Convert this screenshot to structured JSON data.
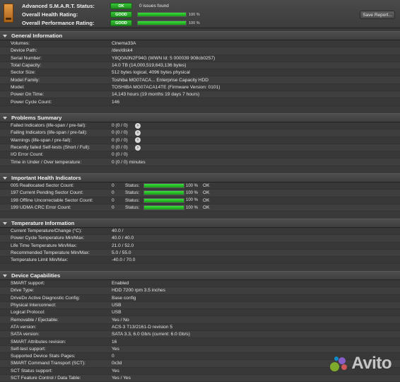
{
  "header": {
    "rows": [
      {
        "label": "Advanced S.M.A.R.T. Status:",
        "badge": "OK",
        "text": "0 issues found"
      },
      {
        "label": "Overall Health Rating:",
        "badge": "GOOD",
        "bar": 1.0,
        "pct": "100 %"
      },
      {
        "label": "Overall Performance Rating:",
        "badge": "GOOD",
        "bar": 1.0,
        "pct": "100 %"
      }
    ],
    "save_label": "Save Report..."
  },
  "general": {
    "title": "General Information",
    "rows": [
      {
        "label": "Volumes:",
        "value": "Cinema33A"
      },
      {
        "label": "Device Path:",
        "value": "/dev/disk4"
      },
      {
        "label": "Serial Number:",
        "value": "Y8Q0A0N2F94G (WWN Id: 5 000039 908cb0257)"
      },
      {
        "label": "Total Capacity:",
        "value": "14.0 TB (14,000,519,643,136 bytes)"
      },
      {
        "label": "Sector Size:",
        "value": "512 bytes logical, 4096 bytes physical"
      },
      {
        "label": "Model Family:",
        "value": "Toshiba MG07ACA... Enterprise Capacity HDD"
      },
      {
        "label": "Model:",
        "value": "TOSHIBA MG07ACA14TE  (Firmware Version: 0101)"
      },
      {
        "label": "Power On Time:",
        "value": "14,143 hours (19 months 19 days 7 hours)"
      },
      {
        "label": "Power Cycle Count:",
        "value": "146"
      }
    ]
  },
  "problems": {
    "title": "Problems Summary",
    "rows": [
      {
        "label": "Failed Indicators (life-span / pre-fail):",
        "value": "0 (0 / 0)",
        "arrow": true
      },
      {
        "label": "Failing Indicators (life-span / pre-fail):",
        "value": "0 (0 / 0)",
        "arrow": true
      },
      {
        "label": "Warnings (life-span / pre-fail):",
        "value": "0 (0 / 0)",
        "arrow": true
      },
      {
        "label": "Recently failed Self-tests (Short / Full):",
        "value": "0 (0 / 0)",
        "arrow": true
      },
      {
        "label": "I/O Error Count:",
        "value": "0 (0 / 0)",
        "arrow": false
      },
      {
        "label": "Time in Under / Over temperature:",
        "value": "0 (0 / 0)   minutes",
        "arrow": false
      }
    ]
  },
  "health": {
    "title": "Important Health Indicators",
    "status_label": "Status:",
    "rows": [
      {
        "label": "005  Reallocated Sector Count:",
        "value": "0",
        "bar": 1.0,
        "pct": "100 %",
        "ok": "OK"
      },
      {
        "label": "197  Current Pending Sector Count:",
        "value": "0",
        "bar": 1.0,
        "pct": "100 %",
        "ok": "OK"
      },
      {
        "label": "198  Offline Uncorrectable Sector Count:",
        "value": "0",
        "bar": 1.0,
        "pct": "100 %",
        "ok": "OK"
      },
      {
        "label": "199  UDMA CRC Error Count:",
        "value": "0",
        "bar": 1.0,
        "pct": "100 %",
        "ok": "OK"
      }
    ]
  },
  "temperature": {
    "title": "Temperature Information",
    "rows": [
      {
        "label": "Current Temperature/Change (°C):",
        "value": "40.0   /"
      },
      {
        "label": "Power Cycle Temperature Min/Max:",
        "value": "40.0   /  40.0"
      },
      {
        "label": "Life Time Temperature Min/Max:",
        "value": "21.0   /  52.0"
      },
      {
        "label": "Recommended Temperature Min/Max:",
        "value": "5.0     /  55.0"
      },
      {
        "label": "Temperature Limit Min/Max:",
        "value": "-40.0  /  70.0"
      }
    ]
  },
  "capabilities": {
    "title": "Device Capabilities",
    "rows": [
      {
        "label": "SMART support:",
        "value": "Enabled"
      },
      {
        "label": "Drive Type:",
        "value": "HDD 7200 rpm 3.5 inches"
      },
      {
        "label": "DriveDx Active Diagnostic Config:",
        "value": "Base config"
      },
      {
        "label": "Physical Interconnect:",
        "value": "USB"
      },
      {
        "label": "Logical Protocol:",
        "value": "USB"
      },
      {
        "label": "Removable / Ejectable:",
        "value": "Yes / No"
      },
      {
        "label": "ATA version:",
        "value": "ACS-3 T13/2161-D revision 5"
      },
      {
        "label": "SATA version:",
        "value": "SATA 3.3, 6.0 Gb/s (current: 6.0 Gb/s)"
      },
      {
        "label": "SMART Attributes revision:",
        "value": "16"
      },
      {
        "label": "Self-test support:",
        "value": "Yes"
      },
      {
        "label": "Supported Device Stats Pages:",
        "value": "0"
      },
      {
        "label": "SMART Command Transport (SCT):",
        "value": "0x3d"
      },
      {
        "label": "SCT Status support:",
        "value": "Yes"
      },
      {
        "label": "SCT Feature Control / Data Table:",
        "value": "Yes / Yes"
      }
    ]
  },
  "watermark": {
    "text": "Avito",
    "colors": [
      "#97cf26",
      "#a169f7",
      "#ff6163",
      "#00aaff"
    ]
  }
}
